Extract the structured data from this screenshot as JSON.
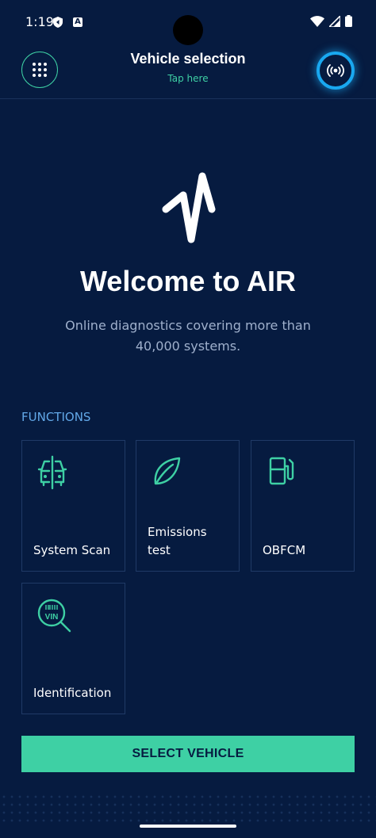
{
  "status_bar": {
    "time": "1:19",
    "icons": [
      "shield-icon",
      "a-badge-icon",
      "wifi-icon",
      "signal-icon",
      "battery-icon"
    ]
  },
  "header": {
    "title": "Vehicle selection",
    "subtitle": "Tap here",
    "menu_icon": "grid-dots-icon",
    "connect_icon": "broadcast-icon"
  },
  "hero": {
    "logo_icon": "air-pulse-logo",
    "title": "Welcome to AIR",
    "subtitle": "Online diagnostics covering more than 40,000 systems."
  },
  "functions": {
    "label": "FUNCTIONS",
    "tiles": [
      {
        "label": "System Scan",
        "icon": "car-scan-icon"
      },
      {
        "label": "Emissions test",
        "icon": "leaf-icon"
      },
      {
        "label": "OBFCM",
        "icon": "fuel-pump-icon"
      },
      {
        "label": "Identification",
        "icon": "vin-search-icon"
      }
    ]
  },
  "primary_action": {
    "label": "SELECT VEHICLE"
  },
  "colors": {
    "background": "#061b40",
    "accent": "#3ed0a4",
    "connect_ring": "#19a8f0",
    "section_label": "#62a8e8",
    "subtitle_text": "#9fb0cc"
  }
}
